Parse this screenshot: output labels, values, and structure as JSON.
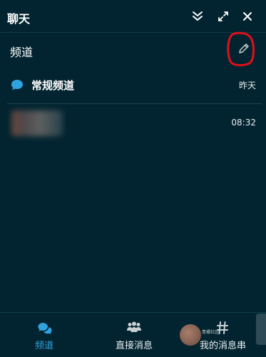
{
  "header": {
    "title": "聊天"
  },
  "section": {
    "title": "频道"
  },
  "channel": {
    "name": "常规频道",
    "time": "昨天"
  },
  "message": {
    "time": "08:32"
  },
  "nav": {
    "items": [
      {
        "label": "频道",
        "icon": "chat-bubbles-icon",
        "active": true
      },
      {
        "label": "直接消息",
        "icon": "people-icon",
        "active": false
      },
      {
        "label": "我的消息串",
        "icon": "hash-icon",
        "active": false
      }
    ]
  },
  "watermark": {
    "text": "青橘社区"
  },
  "colors": {
    "background": "#022430",
    "accent": "#2fa3e0",
    "annotation": "#e0101a"
  }
}
